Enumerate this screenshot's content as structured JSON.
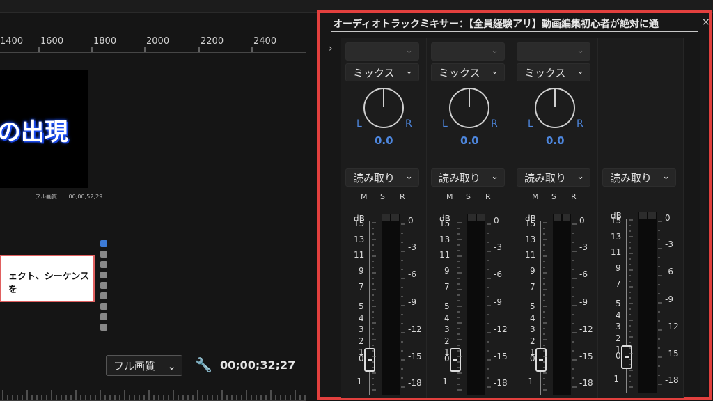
{
  "timeline_ruler": [
    "1400",
    "1600",
    "1800",
    "2000",
    "2200",
    "2400"
  ],
  "program_title": "の出現",
  "mini_controls": {
    "quality": "フル画質",
    "timecode": "00;00;52;29"
  },
  "tooltip_text": "ェクト、シーケンスを",
  "bottom_controls": {
    "quality": "フル画質",
    "timecode": "00;00;32;27",
    "wrench_icon": "wrench-icon"
  },
  "mixer": {
    "title": "オーディオトラックミキサー：【全員経験アリ】動画編集初心者が絶対に通",
    "close": "×",
    "expander": "›",
    "channels": [
      {
        "mode": "ミックス",
        "left": "L",
        "right": "R",
        "pan": "0.0",
        "automation": "読み取り"
      },
      {
        "mode": "ミックス",
        "left": "L",
        "right": "R",
        "pan": "0.0",
        "automation": "読み取り"
      },
      {
        "mode": "ミックス",
        "left": "L",
        "right": "R",
        "pan": "0.0",
        "automation": "読み取り"
      },
      {
        "mode": "",
        "left": "",
        "right": "",
        "pan": "",
        "automation": "読み取り"
      }
    ],
    "msr": [
      "M",
      "S",
      "R"
    ],
    "db_label": "dB",
    "left_scale": [
      "15",
      "13",
      "11",
      "9",
      "7",
      "5",
      "4",
      "3",
      "2",
      "1",
      "0",
      "-1"
    ],
    "right_scale": [
      "0",
      "-3",
      "-6",
      "-9",
      "-12",
      "-15",
      "-18"
    ],
    "colors": {
      "accent_border": "#e2403e",
      "pan_blue": "#4d86dd"
    }
  }
}
